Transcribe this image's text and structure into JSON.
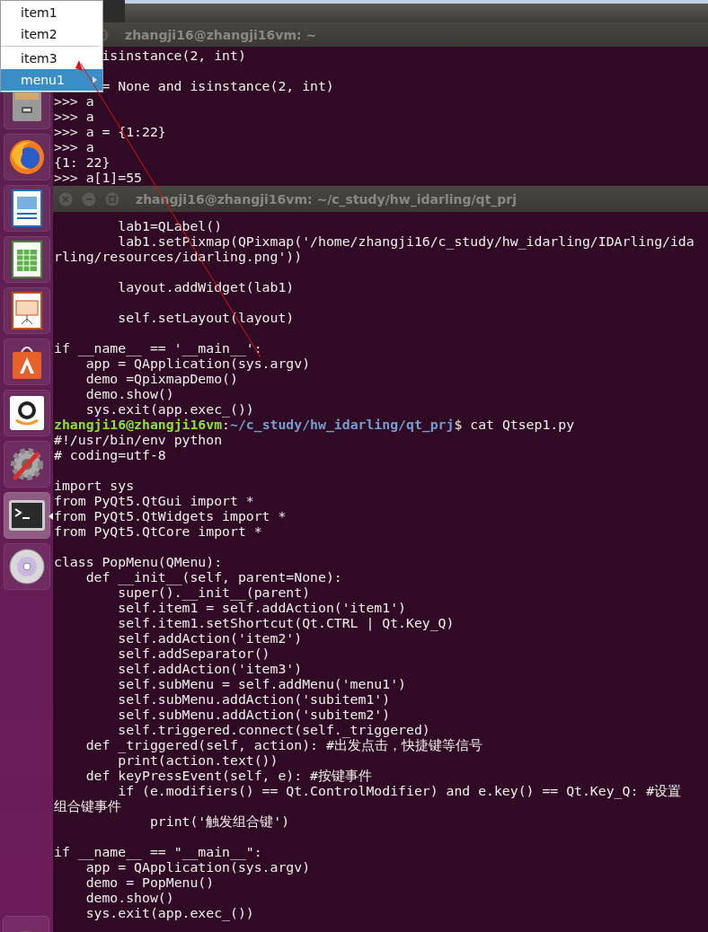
{
  "launcher": {
    "items": [
      {
        "kind": "files",
        "active": false
      },
      {
        "kind": "browser",
        "active": false
      },
      {
        "kind": "document",
        "active": false
      },
      {
        "kind": "spreadsheet",
        "active": false
      },
      {
        "kind": "presentation",
        "active": false
      },
      {
        "kind": "store",
        "active": false
      },
      {
        "kind": "shop",
        "active": false
      },
      {
        "kind": "settings",
        "active": false
      },
      {
        "kind": "terminal",
        "active": true
      },
      {
        "kind": "disc",
        "active": false
      },
      {
        "kind": "trash",
        "active": false
      }
    ]
  },
  "back_terminal": {
    "title": "zhangji16@zhangji16vm: ~",
    "lines": [
      {
        "kind": "covered",
        "text": "isinstance(2, int)"
      },
      {
        "kind": "blank"
      },
      {
        "kind": "covered",
        "text": "= None and isinstance(2, int)"
      },
      {
        "kind": "text",
        "text": ">>> a"
      },
      {
        "kind": "text",
        "text": ">>> a"
      },
      {
        "kind": "text",
        "text": ">>> a = {1:22}"
      },
      {
        "kind": "text",
        "text": ">>> a"
      },
      {
        "kind": "text",
        "text": "{1: 22}"
      },
      {
        "kind": "text",
        "text": ">>> a[1]=55"
      }
    ]
  },
  "front_terminal": {
    "title": "zhangji16@zhangji16vm: ~/c_study/hw_idarling/qt_prj",
    "lines": [
      {
        "kind": "text",
        "text": "        lab1=QLabel()"
      },
      {
        "kind": "text",
        "text": "        lab1.setPixmap(QPixmap('/home/zhangji16/c_study/hw_idarling/IDArling/ida"
      },
      {
        "kind": "text",
        "text": "rling/resources/idarling.png'))"
      },
      {
        "kind": "blank"
      },
      {
        "kind": "text",
        "text": "        layout.addWidget(lab1)"
      },
      {
        "kind": "blank"
      },
      {
        "kind": "text",
        "text": "        self.setLayout(layout)"
      },
      {
        "kind": "blank"
      },
      {
        "kind": "text",
        "text": "if __name__ == '__main__':"
      },
      {
        "kind": "text",
        "text": "    app = QApplication(sys.argv)"
      },
      {
        "kind": "text",
        "text": "    demo =QpixmapDemo()"
      },
      {
        "kind": "text",
        "text": "    demo.show()"
      },
      {
        "kind": "text",
        "text": "    sys.exit(app.exec_())"
      },
      {
        "kind": "prompt",
        "user": "zhangji16@zhangji16vm",
        "separator": ":",
        "path": "~/c_study/hw_idarling/qt_prj",
        "command": "$ cat Qtsep1.py"
      },
      {
        "kind": "text",
        "text": "#!/usr/bin/env python"
      },
      {
        "kind": "text",
        "text": "# coding=utf-8"
      },
      {
        "kind": "blank"
      },
      {
        "kind": "text",
        "text": "import sys"
      },
      {
        "kind": "text",
        "text": "from PyQt5.QtGui import *"
      },
      {
        "kind": "text",
        "text": "from PyQt5.QtWidgets import *"
      },
      {
        "kind": "text",
        "text": "from PyQt5.QtCore import *"
      },
      {
        "kind": "blank"
      },
      {
        "kind": "text",
        "text": "class PopMenu(QMenu):"
      },
      {
        "kind": "text",
        "text": "    def __init__(self, parent=None):"
      },
      {
        "kind": "text",
        "text": "        super().__init__(parent)"
      },
      {
        "kind": "text",
        "text": "        self.item1 = self.addAction('item1')"
      },
      {
        "kind": "text",
        "text": "        self.item1.setShortcut(Qt.CTRL | Qt.Key_Q)"
      },
      {
        "kind": "text",
        "text": "        self.addAction('item2')"
      },
      {
        "kind": "text",
        "text": "        self.addSeparator()"
      },
      {
        "kind": "text",
        "text": "        self.addAction('item3')"
      },
      {
        "kind": "text",
        "text": "        self.subMenu = self.addMenu('menu1')"
      },
      {
        "kind": "text",
        "text": "        self.subMenu.addAction('subitem1')"
      },
      {
        "kind": "text",
        "text": "        self.subMenu.addAction('subitem2')"
      },
      {
        "kind": "text",
        "text": "        self.triggered.connect(self._triggered)"
      },
      {
        "kind": "text",
        "text": "    def _triggered(self, action): #出发点击，快捷键等信号"
      },
      {
        "kind": "text",
        "text": "        print(action.text())"
      },
      {
        "kind": "text",
        "text": "    def keyPressEvent(self, e): #按键事件"
      },
      {
        "kind": "text",
        "text": "        if (e.modifiers() == Qt.ControlModifier) and e.key() == Qt.Key_Q: #设置"
      },
      {
        "kind": "text",
        "text": "组合键事件"
      },
      {
        "kind": "text",
        "text": "            print('触发组合键')"
      },
      {
        "kind": "blank"
      },
      {
        "kind": "text",
        "text": "if __name__ == \"__main__\":"
      },
      {
        "kind": "text",
        "text": "    app = QApplication(sys.argv)"
      },
      {
        "kind": "text",
        "text": "    demo = PopMenu()"
      },
      {
        "kind": "text",
        "text": "    demo.show()"
      },
      {
        "kind": "text",
        "text": "    sys.exit(app.exec_())"
      }
    ]
  },
  "popup_menu": {
    "items": [
      {
        "kind": "action",
        "label": "item1",
        "selected": false
      },
      {
        "kind": "action",
        "label": "item2",
        "selected": false
      },
      {
        "kind": "separator"
      },
      {
        "kind": "action",
        "label": "item3",
        "selected": false
      },
      {
        "kind": "submenu",
        "label": "menu1",
        "selected": true
      }
    ]
  }
}
